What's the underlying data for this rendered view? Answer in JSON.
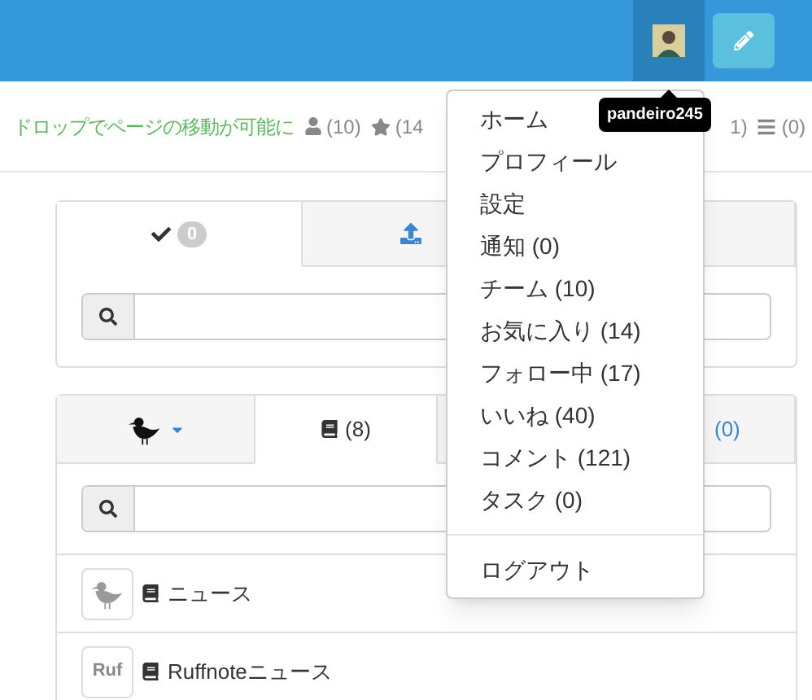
{
  "navbar": {
    "user_tooltip": "pandeiro245"
  },
  "info": {
    "hint": "ドロップでページの移動が可能に",
    "stats": [
      {
        "kind": "user",
        "text": "(10)"
      },
      {
        "kind": "star",
        "text": "(14"
      },
      {
        "kind": "plain",
        "text": "1)"
      },
      {
        "kind": "list",
        "text": "(0)"
      }
    ]
  },
  "menu": {
    "items": [
      "ホーム",
      "プロフィール",
      "設定",
      "通知 (0)",
      "チーム (10)",
      "お気に入り (14)",
      "フォロー中 (17)",
      "いいね (40)",
      "コメント (121)",
      "タスク (0)"
    ],
    "logout": "ログアウト"
  },
  "panel_1": {
    "tabs": [
      {
        "kind": "check",
        "badge": "0",
        "selected": true
      },
      {
        "kind": "upload",
        "selected": false
      }
    ]
  },
  "panel_2": {
    "tabs": [
      {
        "kind": "bird",
        "selected": false
      },
      {
        "kind": "book",
        "label": "(8)",
        "selected": true
      },
      {
        "kind": "blank",
        "selected": false
      },
      {
        "kind": "plain",
        "label": "(0)",
        "selected": false
      }
    ],
    "rows": [
      {
        "kind": "bird",
        "title": "ニュース"
      },
      {
        "kind": "logo",
        "logo_text": "Ruf",
        "title": "Ruffnoteニュース"
      }
    ]
  }
}
